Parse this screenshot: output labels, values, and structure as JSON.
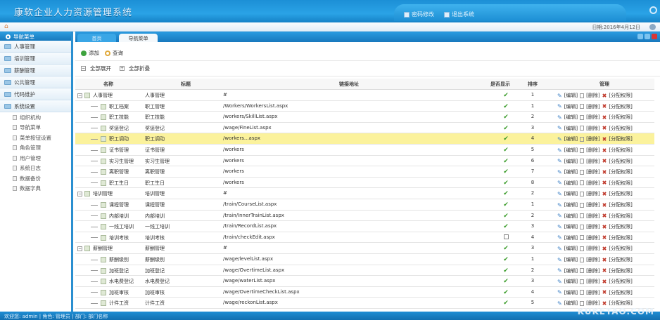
{
  "header": {
    "title": "康软企业人力资源管理系统",
    "nav": [
      {
        "label": "密码修改",
        "icon": "key-icon"
      },
      {
        "label": "退出系统",
        "icon": "exit-icon"
      }
    ]
  },
  "subbar": {
    "date": "日期:2016年4月12日"
  },
  "sidebar": {
    "title": "导航菜单",
    "items": [
      "人事管理",
      "培训管理",
      "薪酬管理",
      "公共管理",
      "代码维护",
      "系统设置"
    ],
    "subitems": [
      "组织机构",
      "导航菜单",
      "菜单按钮设置",
      "角色管理",
      "用户管理",
      "系统日志",
      "数据备份",
      "数据字典"
    ]
  },
  "tabs": [
    {
      "label": "首页"
    },
    {
      "label": "导航菜单"
    }
  ],
  "toolbar": {
    "add": "添加",
    "query": "查询",
    "expand_all": "全部展开",
    "collapse_all": "全部折叠"
  },
  "table": {
    "columns": [
      "名称",
      "标题",
      "链接地址",
      "是否显示",
      "排序",
      "管理"
    ],
    "ops": [
      "[编辑]",
      "[删除]",
      "[分配权限]"
    ],
    "rows": [
      {
        "name": "人事管理",
        "title": "人事管理",
        "url": "#",
        "show": true,
        "sort": "1",
        "level": 0
      },
      {
        "name": "职工档案",
        "title": "职工管理",
        "url": "/Workers/WorkersList.aspx",
        "show": true,
        "sort": "1",
        "level": 1
      },
      {
        "name": "职工技能",
        "title": "职工技能",
        "url": "/workers/SkillList.aspx",
        "show": true,
        "sort": "2",
        "level": 1
      },
      {
        "name": "奖惩登记",
        "title": "奖惩登记",
        "url": "/wage/FineList.aspx",
        "show": true,
        "sort": "3",
        "level": 1
      },
      {
        "name": "职工调动",
        "title": "职工调动",
        "url": "/workers...aspx",
        "show": true,
        "sort": "4",
        "level": 1,
        "selected": true
      },
      {
        "name": "证书管理",
        "title": "证书管理",
        "url": "/workers",
        "show": true,
        "sort": "5",
        "level": 1
      },
      {
        "name": "实习生管理",
        "title": "实习生管理",
        "url": "/workers",
        "show": true,
        "sort": "6",
        "level": 1
      },
      {
        "name": "离职管理",
        "title": "离职管理",
        "url": "/workers",
        "show": true,
        "sort": "7",
        "level": 1
      },
      {
        "name": "职工生日",
        "title": "职工生日",
        "url": "/workers",
        "show": true,
        "sort": "8",
        "level": 1
      },
      {
        "name": "培训管理",
        "title": "培训管理",
        "url": "#",
        "show": true,
        "sort": "2",
        "level": 0
      },
      {
        "name": "课程管理",
        "title": "课程管理",
        "url": "/train/CourseList.aspx",
        "show": true,
        "sort": "1",
        "level": 1
      },
      {
        "name": "内部培训",
        "title": "内部培训",
        "url": "/train/InnerTrainList.aspx",
        "show": true,
        "sort": "2",
        "level": 1
      },
      {
        "name": "一线工培训",
        "title": "一线工培训",
        "url": "/train/RecordList.aspx",
        "show": true,
        "sort": "3",
        "level": 1
      },
      {
        "name": "培训考核",
        "title": "培训考核",
        "url": "/train/checkEdit.aspx",
        "show": false,
        "sort": "4",
        "level": 1
      },
      {
        "name": "薪酬管理",
        "title": "薪酬管理",
        "url": "#",
        "show": true,
        "sort": "3",
        "level": 0
      },
      {
        "name": "薪酬级别",
        "title": "薪酬级别",
        "url": "/wage/levelList.aspx",
        "show": true,
        "sort": "1",
        "level": 1
      },
      {
        "name": "加班登记",
        "title": "加班登记",
        "url": "/wage/OvertimeList.aspx",
        "show": true,
        "sort": "2",
        "level": 1
      },
      {
        "name": "水电费登记",
        "title": "水电费登记",
        "url": "/wage/waterList.aspx",
        "show": true,
        "sort": "3",
        "level": 1
      },
      {
        "name": "加班审核",
        "title": "加班审核",
        "url": "/wage/OvertimeCheckList.aspx",
        "show": true,
        "sort": "4",
        "level": 1
      },
      {
        "name": "计件工资",
        "title": "计件工资",
        "url": "/wage/reckonList.aspx",
        "show": true,
        "sort": "5",
        "level": 1
      }
    ]
  },
  "footer": {
    "text": "欢迎您: admin | 角色: 管理员 | 部门: 部门名称"
  },
  "watermark": "KUKETAO.COM"
}
